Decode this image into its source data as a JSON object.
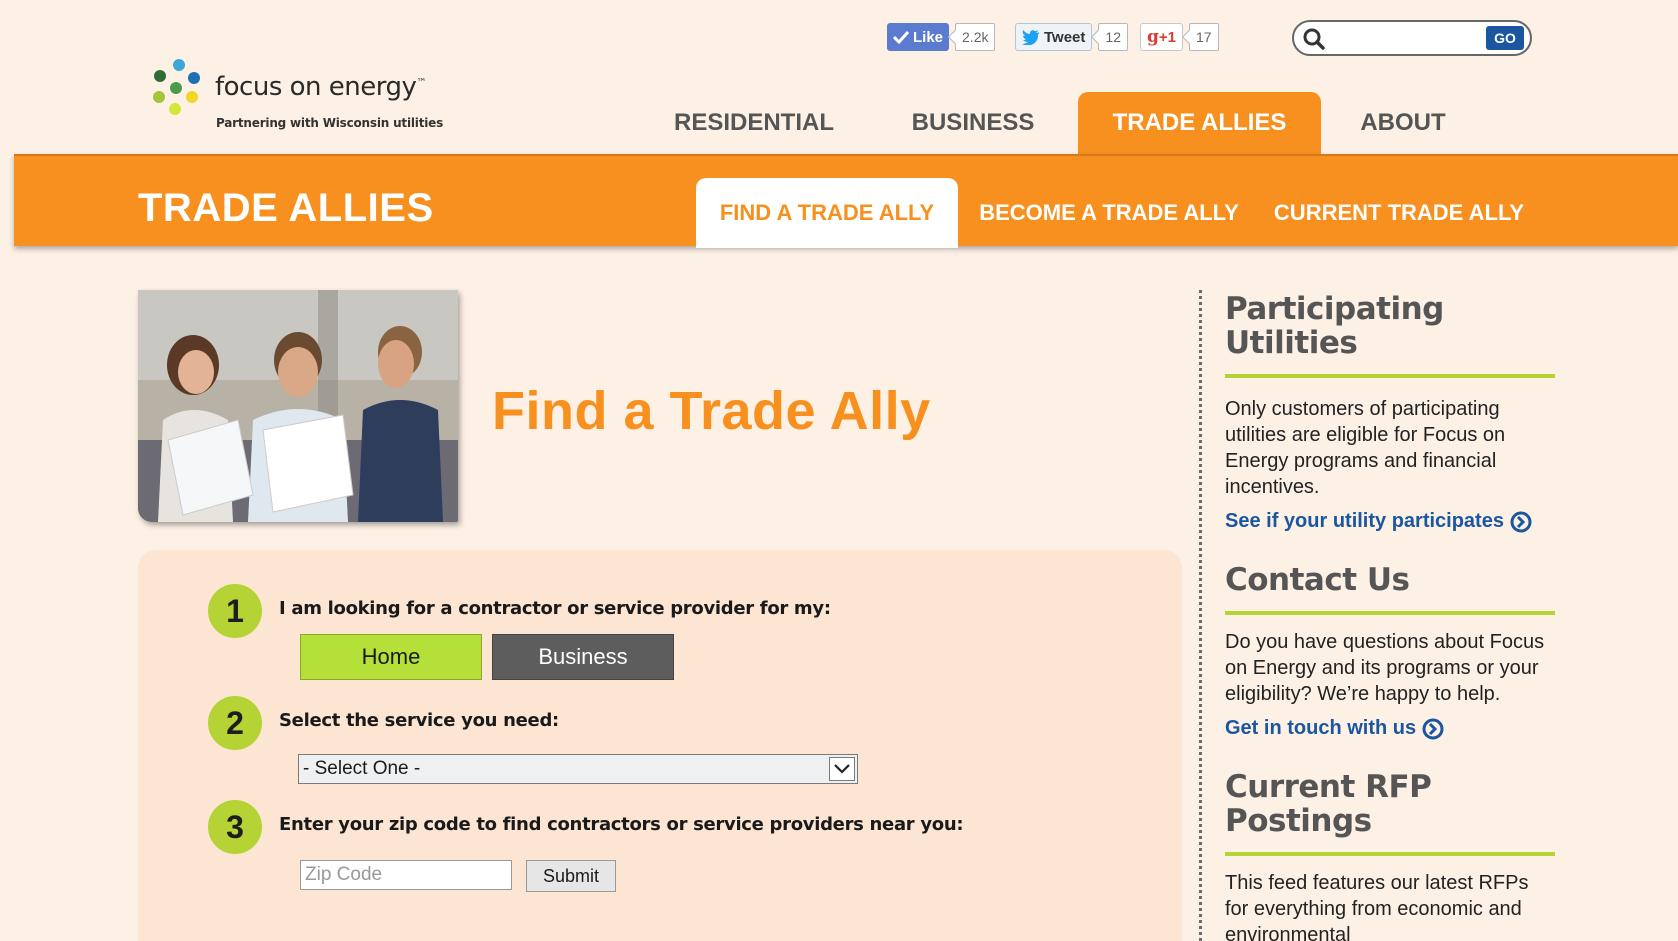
{
  "brand": {
    "name": "focus on energy",
    "trademark": "™",
    "tagline": "Partnering with Wisconsin utilities"
  },
  "social": {
    "like_label": "Like",
    "like_count": "2.2k",
    "tweet_label": "Tweet",
    "tweet_count": "12",
    "gplus_label": "+1",
    "gplus_count": "17"
  },
  "search": {
    "value": "",
    "go_label": "GO"
  },
  "main_nav": {
    "items": [
      "RESIDENTIAL",
      "BUSINESS",
      "TRADE ALLIES",
      "ABOUT"
    ],
    "active": "TRADE ALLIES"
  },
  "section": {
    "title": "TRADE ALLIES"
  },
  "sub_nav": {
    "items": [
      "FIND A TRADE ALLY",
      "BECOME A TRADE ALLY",
      "CURRENT TRADE ALLY"
    ],
    "active": "FIND A TRADE ALLY"
  },
  "page": {
    "title": "Find a Trade Ally"
  },
  "form": {
    "step1": {
      "number": "1",
      "label": "I am looking for a contractor or service provider for my:"
    },
    "home_label": "Home",
    "business_label": "Business",
    "step2": {
      "number": "2",
      "label": "Select the service you need:"
    },
    "service_selected": "- Select One -",
    "step3": {
      "number": "3",
      "label": "Enter your zip code to find contractors or service providers near you:"
    },
    "zip_placeholder": "Zip Code",
    "zip_value": "",
    "submit_label": "Submit"
  },
  "sidebar": {
    "utilities": {
      "heading_line1": "Participating",
      "heading_line2": "Utilities",
      "text": "Only customers of participating utilities are eligible for Focus on Energy programs and financial incentives.",
      "link": "See if your utility participates"
    },
    "contact": {
      "heading": "Contact Us",
      "text": "Do you have questions about Focus on Energy and its programs or your eligibility? We’re happy to help.",
      "link": "Get in touch with us"
    },
    "rfp": {
      "heading": "Current RFP Postings",
      "text": "This feed features our latest RFPs for everything from economic and environmental"
    }
  },
  "colors": {
    "brand_orange": "#f7901e",
    "accent_green": "#b5d334",
    "link_blue": "#1b56a0",
    "background": "#fdf1e6",
    "form_bg": "#fce5d2"
  }
}
